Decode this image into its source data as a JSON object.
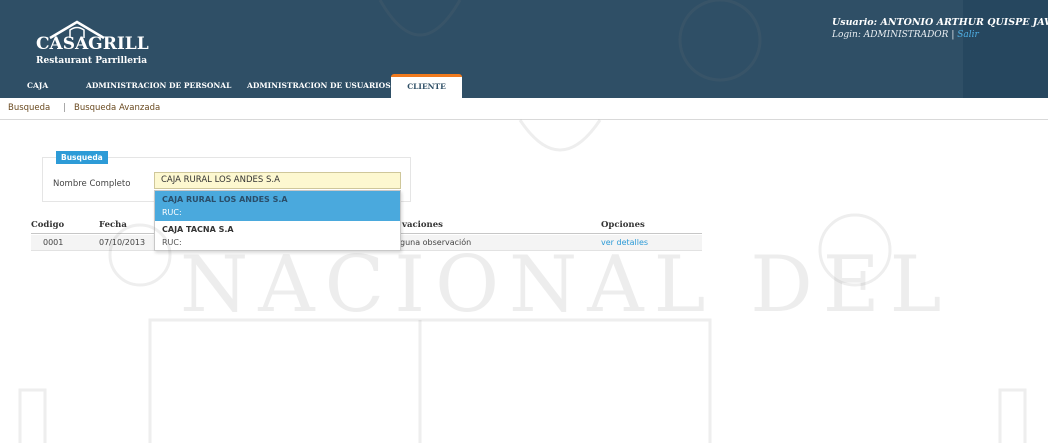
{
  "logo": {
    "main": "CASAGRILL",
    "sub": "Restaurant Parrilleria"
  },
  "user": {
    "name_line": "Usuario: ANTONIO ARTHUR QUISPE JAVIER",
    "login_prefix": "Login: ADMINISTRADOR |",
    "logout": "Salir"
  },
  "tabs": [
    "CAJA",
    "ADMINISTRACION DE PERSONAL",
    "ADMINISTRACION DE USUARIOS",
    "CLIENTE"
  ],
  "subnav": {
    "busqueda": "Busqueda",
    "separator": "|",
    "avanzada": "Busqueda Avanzada"
  },
  "search": {
    "badge": "Busqueda",
    "label": "Nombre Completo",
    "value": "CAJA RURAL LOS ANDES S.A"
  },
  "table": {
    "headers": [
      "Codigo",
      "Fecha",
      "vaciones",
      "Opciones"
    ],
    "rows": [
      {
        "codigo": "0001",
        "fecha": "07/10/2013",
        "observaciones": "guna observación",
        "opciones": "ver detalles"
      }
    ]
  },
  "autocomplete": [
    {
      "name": "CAJA RURAL LOS ANDES S.A",
      "ruc": "RUC:"
    },
    {
      "name": "CAJA TACNA S.A",
      "ruc": "RUC:"
    }
  ],
  "watermark": {
    "text": "NACIONAL  DEL"
  },
  "colors": {
    "header": "#2f4f66",
    "accent": "#f07a1e",
    "link": "#2d9bd7",
    "selected": "#4aa9dd"
  }
}
